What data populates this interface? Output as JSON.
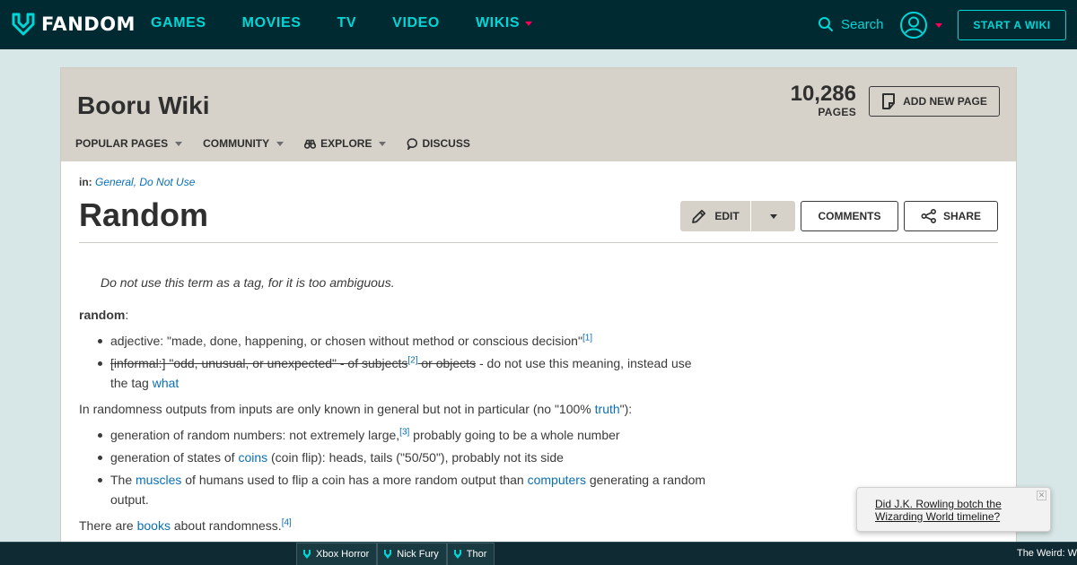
{
  "topbar": {
    "brand": "FANDOM",
    "nav": [
      {
        "label": "GAMES"
      },
      {
        "label": "MOVIES"
      },
      {
        "label": "TV"
      },
      {
        "label": "VIDEO"
      },
      {
        "label": "WIKIS"
      }
    ],
    "search_label": "Search",
    "start_wiki_label": "START A WIKI",
    "accent_color": "#00d6d6",
    "caret_color": "#fa005a"
  },
  "wiki": {
    "title": "Booru Wiki",
    "page_count": "10,286",
    "page_count_label": "PAGES",
    "add_page_label": "ADD NEW PAGE",
    "nav": [
      {
        "label": "POPULAR PAGES"
      },
      {
        "label": "COMMUNITY"
      },
      {
        "label": "EXPLORE"
      },
      {
        "label": "DISCUSS"
      }
    ]
  },
  "article": {
    "categories_prefix": "in:",
    "categories": "General, Do Not Use",
    "title": "Random",
    "edit_label": "EDIT",
    "comments_label": "COMMENTS",
    "share_label": "SHARE",
    "note": "Do not use this term as a tag, for it is too ambiguous.",
    "term": "random",
    "term_colon": ":",
    "defs": {
      "d1_text": "adjective: \"made, done, happening, or chosen without method or conscious decision\"",
      "d1_ref": "[1]",
      "d2_strike_a": "[informal:] \"odd, unusual, or unexpected\" - of subjects",
      "d2_ref": "[2]",
      "d2_strike_b": " or objects",
      "d2_rest": " - do not use this meaning, instead use the tag ",
      "d2_link": "what"
    },
    "para1_a": "In randomness outputs from inputs are only known in general but not in particular (no \"100% ",
    "para1_link": "truth",
    "para1_b": "\"):",
    "list2": {
      "i1_a": "generation of random numbers: not extremely large,",
      "i1_ref": "[3]",
      "i1_b": " probably going to be a whole number",
      "i2_a": "generation of states of ",
      "i2_link": "coins",
      "i2_b": " (coin flip): heads, tails (\"50/50\"), probably not its side",
      "i3_a": "The ",
      "i3_link1": "muscles",
      "i3_b": " of humans used to flip a coin has a more random output than ",
      "i3_link2": "computers",
      "i3_c": " generating a random output."
    },
    "para2_a": "There are ",
    "para2_link": "books",
    "para2_b": " about randomness.",
    "para2_ref": "[4]"
  },
  "popup": {
    "link_text": "Did J.K. Rowling botch the Wizarding World timeline?",
    "close": "✕"
  },
  "bottombar": {
    "tabs": [
      {
        "label": "Xbox Horror"
      },
      {
        "label": "Nick Fury"
      },
      {
        "label": "Thor"
      }
    ],
    "right_text": "The Weird: W"
  }
}
